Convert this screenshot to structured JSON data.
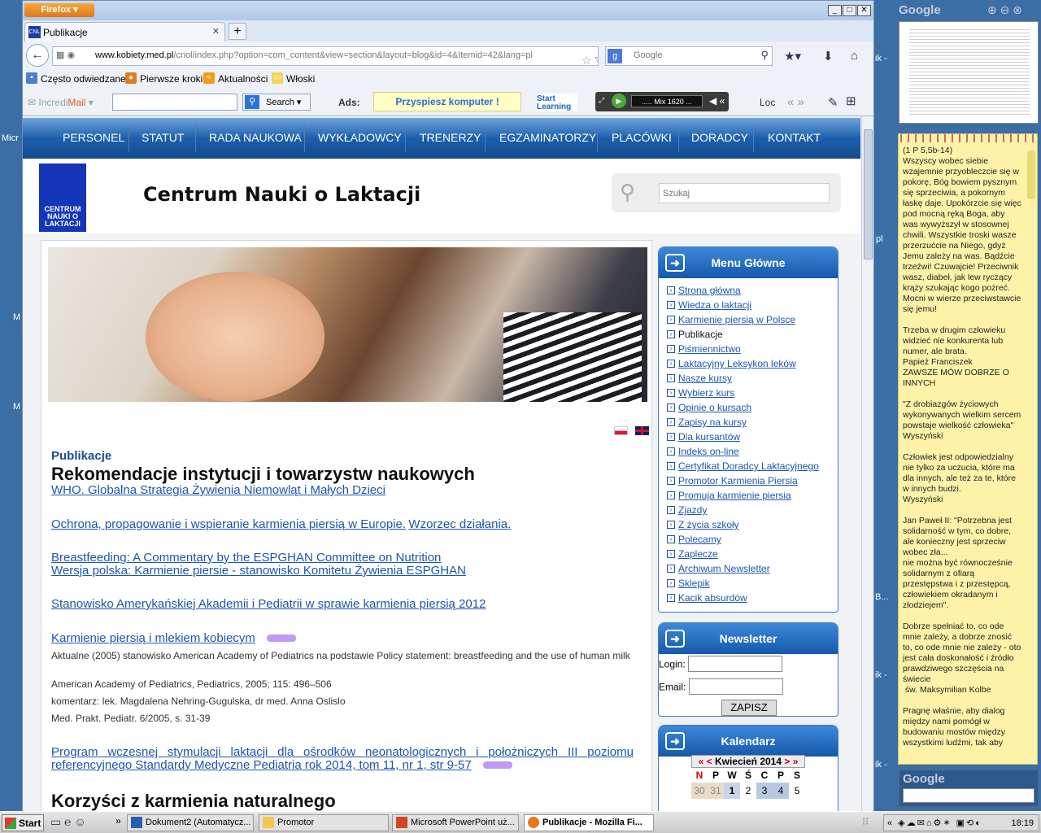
{
  "browser": {
    "firefox_button": "Firefox",
    "tab_title": "Publikacje",
    "new_tab": "+",
    "url_domain": "www.kobiety.med.pl",
    "url_path": "/cnol/index.php?option=com_content&view=section&layout=blog&id=4&Itemid=42&lang=pl",
    "search_placeholder": "Google",
    "bookmarks": [
      "Często odwiedzane",
      "Pierwsze kroki",
      "Aktualności",
      "Włoski"
    ],
    "addons": {
      "incredimail_a": "Incredi",
      "incredimail_b": "Mail",
      "search_label": "Search",
      "ads_label": "Ads:",
      "ad_text": "Przyspiesz komputer !",
      "startlearning": "Start Learning",
      "radio_station": "..... Mix 1620 ...",
      "lod": "Loc"
    }
  },
  "site": {
    "nav": [
      "PERSONEL",
      "STATUT",
      "RADA NAUKOWA",
      "WYKŁADOWCY",
      "TRENERZY",
      "EGZAMINATORZY",
      "PLACÓWKI",
      "DORADCY",
      "KONTAKT"
    ],
    "logo_text": "CENTRUM NAUKI O LAKTACJI",
    "title": "Centrum Nauki o Laktacji",
    "search_placeholder": "Szukaj",
    "section": "Publikacje",
    "heading": "Rekomendacje instytucji i towarzystw naukowych",
    "links": {
      "l1": "WHO. Globalna Strategia Żywienia Niemowląt i Małych Dzieci",
      "l2a": "Ochrona, propagowanie i wspieranie karmienia piersią w Europie.",
      "l2b": "Wzorzec działania.",
      "l3a": "Breastfeeding: A Commentary by the ESPGHAN Committee on Nutrition",
      "l3b": "Wersja polska: Karmienie piersie - stanowisko Komitetu Żywienia ESPGHAN",
      "l4": "Stanowisko Amerykańskiej Akademii i Pediatrii w sprawie karmienia piersią 2012",
      "l5": "Karmienie piersią i mlekiem kobiecym",
      "l6": "Program wczesnej stymulacji laktacji dla ośrodków neonatologicznych i położniczych III poziomu referencyjnego Standardy Medyczne Pediatria rok 2014, tom 11, nr 1, str 9-57"
    },
    "details": {
      "d1": "Aktualne (2005) stanowisko American Academy of Pediatrics na podstawie Policy statement: breastfeeding and the use of human milk",
      "d2": "American Academy of Pediatrics, Pediatrics, 2005; 115: 496–506",
      "d3": "komentarz: lek. Magdalena Nehring-Gugulska, dr med. Anna Oslislo",
      "d4": "Med. Prakt. Pediatr. 6/2005, s. 31-39"
    },
    "next_heading": "Korzyści z karmienia naturalnego",
    "menu_title": "Menu Główne",
    "menu": [
      "Strona główna",
      "Wiedza o laktacji",
      "Karmienie piersią w Polsce",
      "Publikacje",
      "Piśmiennictwo",
      "Laktacyjny Leksykon leków",
      "Nasze kursy",
      "Wybierz kurs",
      "Opinie o kursach",
      "Zapisy na kursy",
      "Dla kursantów",
      "Indeks on-line",
      "Certyfikat Doradcy Laktacyjnego",
      "Promotor Karmienia Piersia",
      "Promuja karmienie piersia",
      "Zjazdy",
      "Z życia szkoły",
      "Polecamy",
      "Zaplecze",
      "Archiwum Newsletter",
      "Sklepik",
      "Kacik absurdów"
    ],
    "menu_active_index": 3,
    "newsletter_title": "Newsletter",
    "login_label": "Login:",
    "email_label": "Email:",
    "submit_label": "ZAPISZ",
    "calendar_title": "Kalendarz",
    "calendar_month": "Kwiecień 2014",
    "calendar_prev": "« <",
    "calendar_next": "> »",
    "weekdays": [
      "N",
      "P",
      "W",
      "Ś",
      "C",
      "P",
      "S"
    ],
    "calendar_row": [
      "30",
      "31",
      "1",
      "2",
      "3",
      "4",
      "5"
    ]
  },
  "gadgets": {
    "google_title": "Google",
    "note": "(1 P 5,5b-14)\nWszyscy wobec siebie wzajemnie przyobleczcie się w pokorę, Bóg bowiem pysznym się sprzeciwia, a pokornym łaskę daje. Upokórzcie się więc pod mocną ręką Boga, aby was wywyższył w stosownej chwili. Wszystkie troski wasze przerzućcie na Niego, gdyż Jemu zależy na was. Bądźcie trzeźwi! Czuwajcie! Przeciwnik wasz, diabeł, jak lew ryczący krąży szukając kogo pożreć. Mocni w wierze przeciwstawcie się jemu!\n\nTrzeba w drugim człowieku widzieć nie konkurenta lub numer, ale brata.\nPapież Franciszek\nZAWSZE MÓW DOBRZE O INNYCH\n\n\"Z drobiazgów życiowych wykonywanych wielkim sercem powstaje wielkość człowieka\" Wyszyński\n\nCzłowiek jest odpowiedzialny nie tylko za uczucia, które ma dla innych, ale też za te, które w innych budzi.\nWyszyński\n\nJan Paweł II: \"Potrzebna jest solidarność w tym, co dobre, ale konieczny jest sprzeciw wobec zła...\nnie można być równocześnie solidarnym z ofiarą przestępstwa i z przestępcą, człowiekiem okradanym i złodziejem\".\n\nDobrze spełniać to, co ode mnie zależy, a dobrze znosić to, co ode mnie nie zależy - oto jest cała doskonałość i źródło prawdziwego szczęścia na świecie\n św. Maksymilian Kolbe\n\nPragnę właśnie, aby dialog między nami pomógł w budowaniu mostów między wszystkimi ludźmi, tak aby",
    "google_search_title": "Google"
  },
  "taskbar": {
    "start": "Start",
    "items": [
      "Dokument2 (Automatycz...",
      "Promotor",
      "Microsoft PowerPoint uż...",
      "Publikacje - Mozilla Fi..."
    ],
    "clock": "18:19"
  },
  "desktop": {
    "edge_labels": [
      "Micr",
      "pl",
      "M",
      "M",
      "B...",
      "ik -",
      "ik -",
      "ik -"
    ]
  },
  "colors": {
    "nav_blue": "#1d5fac",
    "link": "#1c55ad",
    "note_yellow": "#fdf2a8"
  }
}
